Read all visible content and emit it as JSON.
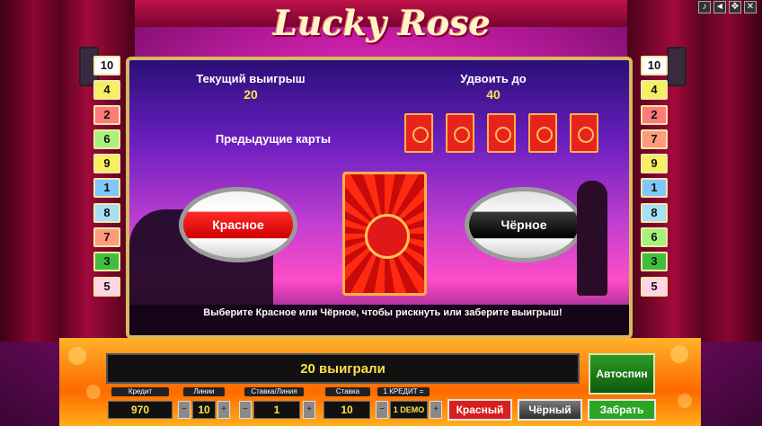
{
  "logo_text": "Lucky Rose",
  "top_icons": [
    "music-icon",
    "sound-icon",
    "fullscreen-icon",
    "close-icon"
  ],
  "paylines_left": [
    {
      "n": "10",
      "color": "#ffffff"
    },
    {
      "n": "4",
      "color": "#f7ef62"
    },
    {
      "n": "2",
      "color": "#ff7a7a"
    },
    {
      "n": "6",
      "color": "#a6f27a"
    },
    {
      "n": "9",
      "color": "#f7ef62"
    },
    {
      "n": "1",
      "color": "#7fc7ff"
    },
    {
      "n": "8",
      "color": "#a6e0f7"
    },
    {
      "n": "7",
      "color": "#ff9a7a"
    },
    {
      "n": "3",
      "color": "#3fbf3f"
    },
    {
      "n": "5",
      "color": "#ffd3e8"
    }
  ],
  "paylines_right": [
    {
      "n": "10",
      "color": "#ffffff"
    },
    {
      "n": "4",
      "color": "#f7ef62"
    },
    {
      "n": "2",
      "color": "#ff7a7a"
    },
    {
      "n": "7",
      "color": "#ff9a7a"
    },
    {
      "n": "9",
      "color": "#f7ef62"
    },
    {
      "n": "1",
      "color": "#7fc7ff"
    },
    {
      "n": "8",
      "color": "#a6e0f7"
    },
    {
      "n": "6",
      "color": "#a6f27a"
    },
    {
      "n": "3",
      "color": "#3fbf3f"
    },
    {
      "n": "5",
      "color": "#ffd3e8"
    }
  ],
  "gamble": {
    "current_win_label": "Текущий выигрыш",
    "current_win_value": "20",
    "double_to_label": "Удвоить до",
    "double_to_value": "40",
    "previous_cards_label": "Предыдущие карты",
    "red_label": "Красное",
    "black_label": "Чёрное",
    "instruction": "Выберите Красное или Чёрное, чтобы рискнуть или заберите выигрыш!"
  },
  "message": "20 выиграли",
  "autospin_label": "Автоспин",
  "controls": {
    "credit_label": "Кредит",
    "credit_value": "970",
    "lines_label": "Линии",
    "lines_value": "10",
    "bet_line_label": "Ставка/Линия",
    "bet_line_value": "1",
    "bet_label": "Ставка",
    "bet_value": "10",
    "credit_ratio_label": "1 КРЕДИТ =",
    "credit_ratio_value": "1 DEMO",
    "minus": "−",
    "plus": "+"
  },
  "buttons": {
    "red": "Красный",
    "black": "Чёрный",
    "take": "Забрать"
  },
  "colors": {
    "accent_yellow": "#ffe24a",
    "red_button": "#d81e1e",
    "black_button": "#4a4a4a",
    "take_button": "#2aa623"
  }
}
